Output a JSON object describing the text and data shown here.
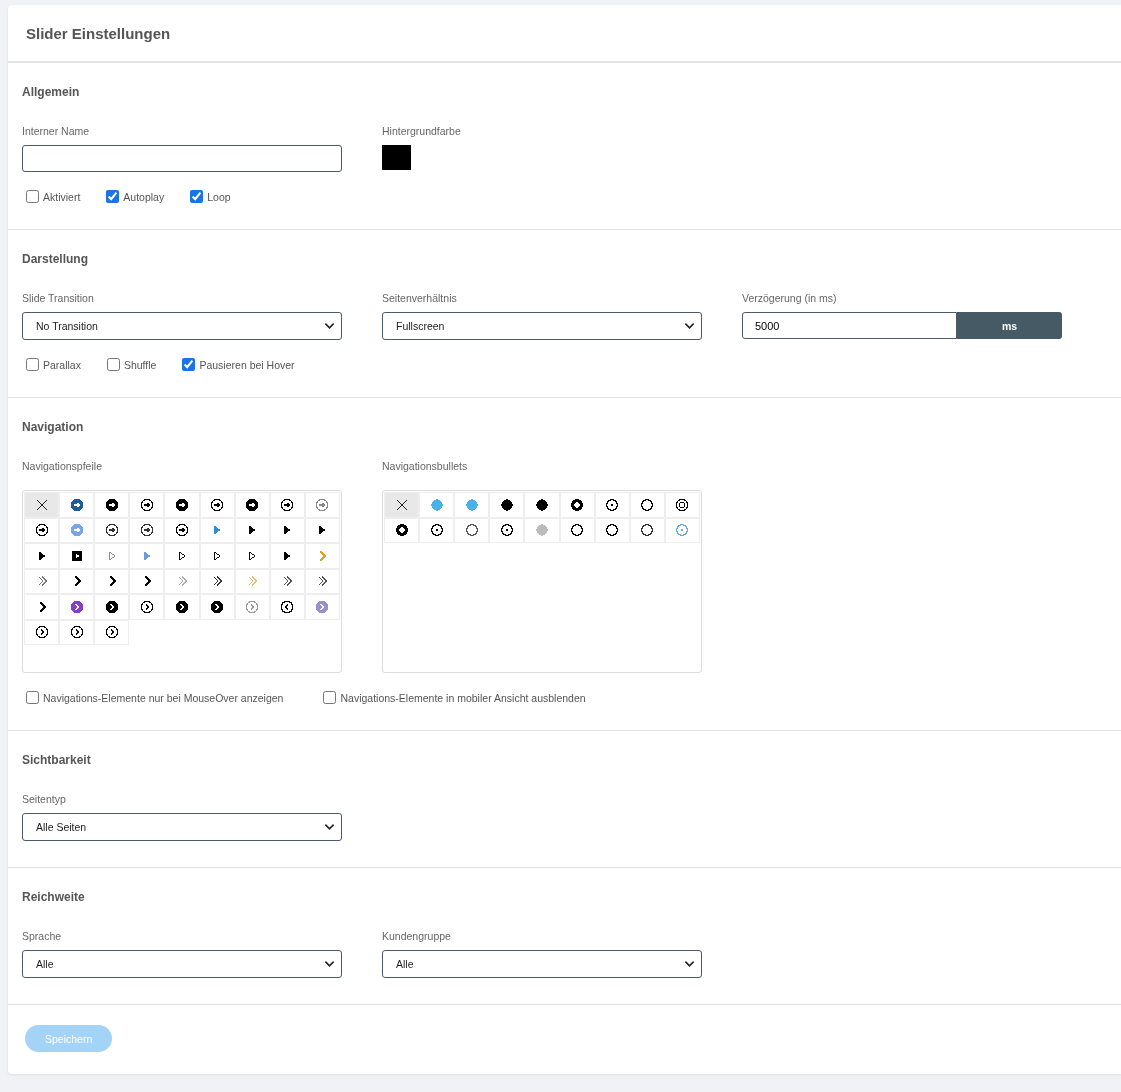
{
  "title": "Slider Einstellungen",
  "general": {
    "heading": "Allgemein",
    "name_label": "Interner Name",
    "color_label": "Hintergrundfarbe",
    "color": "#000000",
    "checkboxes": [
      {
        "label": "Aktiviert",
        "checked": false
      },
      {
        "label": "Autoplay",
        "checked": true
      },
      {
        "label": "Loop",
        "checked": true
      }
    ]
  },
  "display": {
    "heading": "Darstellung",
    "selects": [
      {
        "label": "Slide Transition",
        "value": "No Transition"
      },
      {
        "label": "Seitenverhältnis",
        "value": "Fullscreen"
      }
    ],
    "delay": {
      "label": "Verzögerung (in ms)",
      "value": "5000",
      "unit": "ms"
    },
    "checkboxes": [
      {
        "label": "Parallax",
        "checked": false
      },
      {
        "label": "Shuffle",
        "checked": false
      },
      {
        "label": "Pausieren bei Hover",
        "checked": true
      }
    ]
  },
  "navigation": {
    "heading": "Navigation",
    "arrows_label": "Navigationspfeile",
    "bullets_label": "Navigationsbullets",
    "arrows": [
      {
        "kind": "none",
        "color": "#222222",
        "selected": true
      },
      {
        "kind": "arrow-disc",
        "color": "#1e5c9a",
        "selected": false
      },
      {
        "kind": "arrow-disc",
        "color": "#000000",
        "selected": false
      },
      {
        "kind": "arrow-ring",
        "color": "#000000",
        "selected": false
      },
      {
        "kind": "arrow-disc",
        "color": "#000000",
        "selected": false
      },
      {
        "kind": "arrow-ring",
        "color": "#000000",
        "selected": false
      },
      {
        "kind": "arrow-disc",
        "color": "#000000",
        "selected": false
      },
      {
        "kind": "arrow-ring",
        "color": "#000000",
        "selected": false
      },
      {
        "kind": "arrow-ring",
        "color": "#888888",
        "selected": false
      },
      {
        "kind": "arrow-ring",
        "color": "#000000",
        "selected": false
      },
      {
        "kind": "arrow-disc",
        "color": "#7aa6e6",
        "selected": false
      },
      {
        "kind": "arrow-ring",
        "color": "#333333",
        "selected": false
      },
      {
        "kind": "arrow-ring",
        "color": "#333333",
        "selected": false
      },
      {
        "kind": "arrow-ring",
        "color": "#000000",
        "selected": false
      },
      {
        "kind": "triangle",
        "color": "#2a8fd8",
        "selected": false
      },
      {
        "kind": "triangle",
        "color": "#000000",
        "selected": false
      },
      {
        "kind": "triangle",
        "color": "#000000",
        "selected": false
      },
      {
        "kind": "triangle",
        "color": "#000000",
        "selected": false
      },
      {
        "kind": "triangle",
        "color": "#000000",
        "selected": false
      },
      {
        "kind": "square-triangle",
        "color": "#000000",
        "selected": false
      },
      {
        "kind": "triangle-outline",
        "color": "#888888",
        "selected": false
      },
      {
        "kind": "triangle",
        "color": "#6b9be0",
        "selected": false
      },
      {
        "kind": "triangle-outline",
        "color": "#000000",
        "selected": false
      },
      {
        "kind": "triangle-outline",
        "color": "#000000",
        "selected": false
      },
      {
        "kind": "triangle-outline",
        "color": "#000000",
        "selected": false
      },
      {
        "kind": "triangle",
        "color": "#000000",
        "selected": false
      },
      {
        "kind": "chevron",
        "color": "#e0a020",
        "selected": false
      },
      {
        "kind": "double-chevron",
        "color": "#777777",
        "selected": false
      },
      {
        "kind": "chevron",
        "color": "#000000",
        "selected": false
      },
      {
        "kind": "chevron",
        "color": "#000000",
        "selected": false
      },
      {
        "kind": "chevron",
        "color": "#000000",
        "selected": false
      },
      {
        "kind": "double-chevron",
        "color": "#aaaaaa",
        "selected": false
      },
      {
        "kind": "double-chevron",
        "color": "#333333",
        "selected": false
      },
      {
        "kind": "double-chevron",
        "color": "#e0c070",
        "selected": false
      },
      {
        "kind": "double-chevron",
        "color": "#555555",
        "selected": false
      },
      {
        "kind": "double-chevron",
        "color": "#555555",
        "selected": false
      },
      {
        "kind": "chevron",
        "color": "#000000",
        "selected": false
      },
      {
        "kind": "chevron-disc",
        "color": "#8a3fc0",
        "selected": false
      },
      {
        "kind": "chevron-disc",
        "color": "#000000",
        "selected": false
      },
      {
        "kind": "chevron-ring",
        "color": "#000000",
        "selected": false
      },
      {
        "kind": "chevron-disc",
        "color": "#000000",
        "selected": false
      },
      {
        "kind": "chevron-disc",
        "color": "#000000",
        "selected": false
      },
      {
        "kind": "chevron-ring",
        "color": "#999999",
        "selected": false
      },
      {
        "kind": "chevron-ring-left",
        "color": "#000000",
        "selected": false
      },
      {
        "kind": "chevron-disc",
        "color": "#9a8fd0",
        "selected": false
      },
      {
        "kind": "chevron-ring",
        "color": "#000000",
        "selected": false
      },
      {
        "kind": "chevron-ring",
        "color": "#000000",
        "selected": false
      },
      {
        "kind": "chevron-ring",
        "color": "#000000",
        "selected": false
      }
    ],
    "bullets": [
      {
        "kind": "none",
        "color": "#222222",
        "selected": true
      },
      {
        "kind": "dot",
        "color": "#4ab0e8",
        "selected": false
      },
      {
        "kind": "dot",
        "color": "#4ab0e8",
        "selected": false
      },
      {
        "kind": "dot",
        "color": "#000000",
        "selected": false
      },
      {
        "kind": "dot",
        "color": "#000000",
        "selected": false
      },
      {
        "kind": "ring-thick",
        "color": "#000000",
        "selected": false
      },
      {
        "kind": "ring-dot",
        "color": "#000000",
        "selected": false
      },
      {
        "kind": "ring",
        "color": "#000000",
        "selected": false
      },
      {
        "kind": "double-ring",
        "color": "#000000",
        "selected": false
      },
      {
        "kind": "ring-thick",
        "color": "#000000",
        "selected": false
      },
      {
        "kind": "ring-dot",
        "color": "#000000",
        "selected": false
      },
      {
        "kind": "ring",
        "color": "#555555",
        "selected": false
      },
      {
        "kind": "ring-dot",
        "color": "#000000",
        "selected": false
      },
      {
        "kind": "dot",
        "color": "#bbbbbb",
        "selected": false
      },
      {
        "kind": "ring",
        "color": "#000000",
        "selected": false
      },
      {
        "kind": "ring",
        "color": "#000000",
        "selected": false
      },
      {
        "kind": "ring",
        "color": "#333333",
        "selected": false
      },
      {
        "kind": "ring-dot",
        "color": "#6fa8dc",
        "selected": false
      }
    ],
    "checkboxes": [
      {
        "label": "Navigations-Elemente nur bei MouseOver anzeigen",
        "checked": false
      },
      {
        "label": "Navigations-Elemente in mobiler Ansicht ausblenden",
        "checked": false
      }
    ]
  },
  "visibility": {
    "heading": "Sichtbarkeit",
    "selects": [
      {
        "label": "Seitentyp",
        "value": "Alle Seiten"
      }
    ]
  },
  "reach": {
    "heading": "Reichweite",
    "selects": [
      {
        "label": "Sprache",
        "value": "Alle"
      },
      {
        "label": "Kundengruppe",
        "value": "Alle"
      }
    ]
  },
  "save_button": {
    "label": "Speichern",
    "disabled": true
  }
}
